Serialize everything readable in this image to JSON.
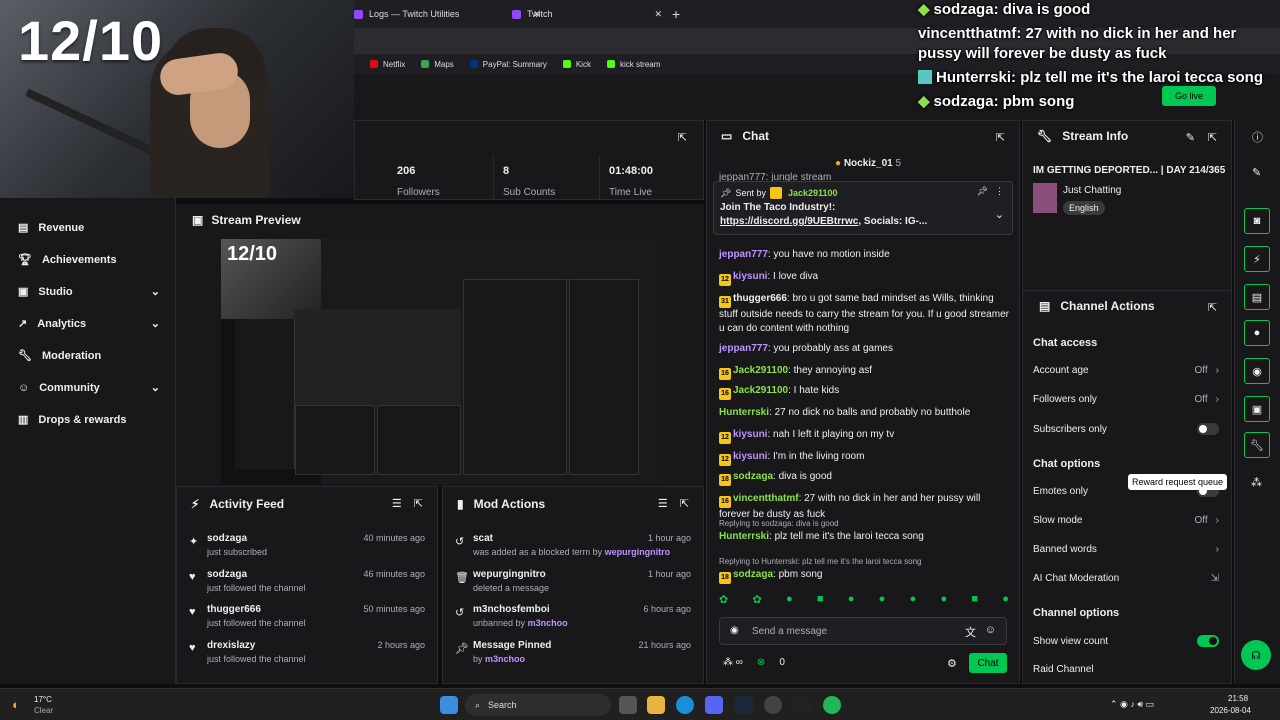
{
  "browser": {
    "tabs": [
      {
        "label": "Logs — Twitch Utilities"
      },
      {
        "label": "Twitch"
      }
    ],
    "bookmarks": [
      "Netflix",
      "Maps",
      "PayPal: Summary",
      "Kick",
      "kick stream"
    ]
  },
  "overlay": {
    "score": "12/10",
    "chat": [
      {
        "user": "sodzaga",
        "text": "diva is good"
      },
      {
        "user": "vincentthatmf",
        "text": "27 with no dick in her and her pussy will forever be dusty as fuck"
      },
      {
        "user": "Hunterrski",
        "text": "plz tell me it's the laroi tecca song"
      },
      {
        "user": "sodzaga",
        "text": "pbm song"
      }
    ],
    "go_live": "Go live"
  },
  "leftnav": {
    "items": [
      {
        "label": "Revenue",
        "icon": "dollar-icon"
      },
      {
        "label": "Achievements",
        "icon": "trophy-icon"
      },
      {
        "label": "Studio",
        "icon": "studio-icon",
        "expandable": true
      },
      {
        "label": "Analytics",
        "icon": "analytics-icon",
        "expandable": true
      },
      {
        "label": "Moderation",
        "icon": "wrench-icon"
      },
      {
        "label": "Community",
        "icon": "community-icon",
        "expandable": true
      },
      {
        "label": "Drops & rewards",
        "icon": "drops-icon"
      }
    ]
  },
  "stats": [
    {
      "value": "206",
      "label": "Followers"
    },
    {
      "value": "8",
      "label": "Sub Counts"
    },
    {
      "value": "01:48:00",
      "label": "Time Live"
    }
  ],
  "preview": {
    "title": "Stream Preview",
    "overlay_score": "12/10"
  },
  "activity": {
    "title": "Activity Feed",
    "items": [
      {
        "user": "sodzaga",
        "action": "just subscribed",
        "time": "40 minutes ago",
        "icon": "star-icon"
      },
      {
        "user": "sodzaga",
        "action": "just followed the channel",
        "time": "46 minutes ago",
        "icon": "heart-icon"
      },
      {
        "user": "thugger666",
        "action": "just followed the channel",
        "time": "50 minutes ago",
        "icon": "heart-icon"
      },
      {
        "user": "drexislazy",
        "action": "just followed the channel",
        "time": "2 hours ago",
        "icon": "heart-icon"
      }
    ]
  },
  "modactions": {
    "title": "Mod Actions",
    "items": [
      {
        "title": "scat",
        "sub": "was added as a blocked term by",
        "by": "wepurgingnitro",
        "time": "1 hour ago",
        "icon": "undo-icon"
      },
      {
        "title": "wepurgingnitro",
        "sub": "deleted a message",
        "by": "",
        "time": "1 hour ago",
        "icon": "trash-icon"
      },
      {
        "title": "m3nchosfemboi",
        "sub": "unbanned by",
        "by": "m3nchoo",
        "time": "6 hours ago",
        "icon": "undo-icon"
      },
      {
        "title": "Message Pinned",
        "sub": "by",
        "by": "m3nchoo",
        "time": "21 hours ago",
        "icon": "pin-icon"
      }
    ]
  },
  "chat": {
    "title": "Chat",
    "top_user": "Nockiz_01",
    "top_count": "5",
    "partial_msg": "jeppan777: jungle stream",
    "pinned": {
      "sent_by_label": "Sent by",
      "sender": "Jack291100",
      "text": "Join The Taco Industry!",
      "socials": ": ",
      "link": "https://discord.gg/9UEBtrrwc",
      "link_rest": ", Socials: IG-..."
    },
    "messages": [
      {
        "badge": "",
        "user": "jeppan777",
        "color": "#bf94ff",
        "text": "you have no motion inside"
      },
      {
        "badge": "12",
        "user": "kiysuni",
        "color": "#bf94ff",
        "text": "I love diva"
      },
      {
        "badge": "31",
        "user": "thugger666",
        "color": "#efeff1",
        "text": "bro u got same bad mindset as Wills, thinking stuff outside needs to carry the stream for you. If u good streamer u can do content with nothing"
      },
      {
        "badge": "",
        "user": "jeppan777",
        "color": "#bf94ff",
        "text": "you probably ass at games"
      },
      {
        "badge": "16",
        "user": "Jack291100",
        "color": "#8ce14a",
        "text": "they annoying asf"
      },
      {
        "badge": "16",
        "user": "Jack291100",
        "color": "#8ce14a",
        "text": "I hate kids"
      },
      {
        "badge": "",
        "user": "Hunterrski",
        "color": "#8ce14a",
        "text": "27 no dick no balls and probably no butthole"
      },
      {
        "badge": "12",
        "user": "kiysuni",
        "color": "#bf94ff",
        "text": "nah I left it playing on my tv"
      },
      {
        "badge": "12",
        "user": "kiysuni",
        "color": "#bf94ff",
        "text": "I'm in the living room"
      },
      {
        "badge": "18",
        "user": "sodzaga",
        "color": "#8ce14a",
        "text": "diva is good"
      },
      {
        "badge": "16",
        "user": "vincentthatmf",
        "color": "#8ce14a",
        "text": "27 with no dick in her and her pussy will forever be dusty as fuck"
      },
      {
        "reply": "Replying to sodzaga: diva is good",
        "badge": "",
        "user": "Hunterrski",
        "color": "#8ce14a",
        "text": "plz tell me it's the laroi tecca song"
      },
      {
        "reply": "Replying to Hunterrski: plz tell me it's the laroi tecca song",
        "badge": "18",
        "user": "sodzaga",
        "color": "#8ce14a",
        "text": "pbm song"
      }
    ],
    "input_placeholder": "Send a message",
    "points": "0",
    "send_label": "Chat"
  },
  "streaminfo": {
    "title": "Stream Info",
    "stream_title": "IM GETTING DEPORTED... | DAY 214/365",
    "category": "Just Chatting",
    "tag": "English"
  },
  "channelactions": {
    "title": "Channel Actions",
    "chat_access": "Chat access",
    "account_age": {
      "label": "Account age",
      "value": "Off"
    },
    "followers_only": {
      "label": "Followers only",
      "value": "Off"
    },
    "subscribers_only": {
      "label": "Subscribers only"
    },
    "chat_options": "Chat options",
    "emotes_only": {
      "label": "Emotes only"
    },
    "slow_mode": {
      "label": "Slow mode",
      "value": "Off"
    },
    "banned_words": {
      "label": "Banned words"
    },
    "ai_moderation": {
      "label": "AI Chat Moderation"
    },
    "channel_options": "Channel options",
    "show_view_count": {
      "label": "Show view count"
    },
    "raid_channel": {
      "label": "Raid Channel"
    }
  },
  "tooltip": "Reward request queue",
  "taskbar": {
    "weather_temp": "17°C",
    "weather_desc": "Clear",
    "search": "Search",
    "time": "21:58",
    "date": "2026-08-04"
  },
  "colors": {
    "accent": "#00c853",
    "twitch_purple": "#9147ff",
    "panel": "#18181b"
  }
}
